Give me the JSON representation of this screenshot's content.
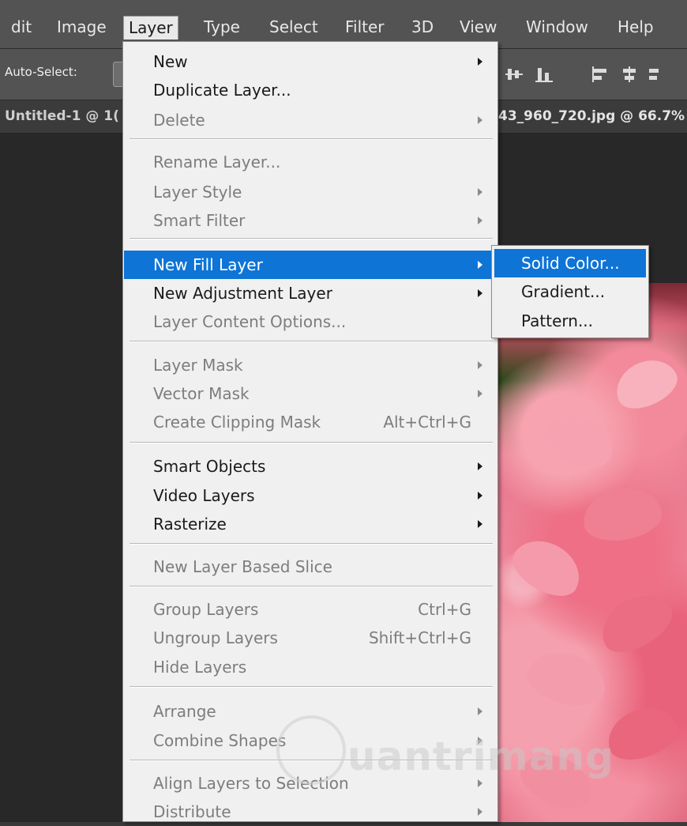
{
  "menubar": {
    "items": [
      {
        "label": "dit"
      },
      {
        "label": "Image"
      },
      {
        "label": "Layer"
      },
      {
        "label": "Type"
      },
      {
        "label": "Select"
      },
      {
        "label": "Filter"
      },
      {
        "label": "3D"
      },
      {
        "label": "View"
      },
      {
        "label": "Window"
      },
      {
        "label": "Help"
      }
    ]
  },
  "options": {
    "auto_select": "Auto-Select:"
  },
  "tabs": {
    "left": "Untitled-1 @ 1(",
    "right": "43_960_720.jpg @ 66.7%"
  },
  "layer_menu": {
    "items": [
      {
        "label": "New",
        "state": "enabled",
        "submenu": true
      },
      {
        "label": "Duplicate Layer...",
        "state": "enabled"
      },
      {
        "label": "Delete",
        "state": "disabled",
        "submenu": true
      },
      {
        "label": "Rename Layer...",
        "state": "disabled"
      },
      {
        "label": "Layer Style",
        "state": "disabled",
        "submenu": true
      },
      {
        "label": "Smart Filter",
        "state": "disabled",
        "submenu": true
      },
      {
        "label": "New Fill Layer",
        "state": "highlighted",
        "submenu": true
      },
      {
        "label": "New Adjustment Layer",
        "state": "enabled",
        "submenu": true
      },
      {
        "label": "Layer Content Options...",
        "state": "disabled"
      },
      {
        "label": "Layer Mask",
        "state": "disabled",
        "submenu": true
      },
      {
        "label": "Vector Mask",
        "state": "disabled",
        "submenu": true
      },
      {
        "label": "Create Clipping Mask",
        "state": "disabled",
        "shortcut": "Alt+Ctrl+G"
      },
      {
        "label": "Smart Objects",
        "state": "enabled",
        "submenu": true
      },
      {
        "label": "Video Layers",
        "state": "enabled",
        "submenu": true
      },
      {
        "label": "Rasterize",
        "state": "enabled",
        "submenu": true
      },
      {
        "label": "New Layer Based Slice",
        "state": "disabled"
      },
      {
        "label": "Group Layers",
        "state": "disabled",
        "shortcut": "Ctrl+G"
      },
      {
        "label": "Ungroup Layers",
        "state": "disabled",
        "shortcut": "Shift+Ctrl+G"
      },
      {
        "label": "Hide Layers",
        "state": "disabled"
      },
      {
        "label": "Arrange",
        "state": "disabled",
        "submenu": true
      },
      {
        "label": "Combine Shapes",
        "state": "disabled",
        "submenu": true
      },
      {
        "label": "Align Layers to Selection",
        "state": "disabled",
        "submenu": true
      },
      {
        "label": "Distribute",
        "state": "disabled",
        "submenu": true
      }
    ]
  },
  "fill_submenu": {
    "items": [
      {
        "label": "Solid Color...",
        "state": "highlighted"
      },
      {
        "label": "Gradient...",
        "state": "enabled"
      },
      {
        "label": "Pattern...",
        "state": "enabled"
      }
    ]
  },
  "watermark": {
    "text": "uantrimang"
  },
  "colors": {
    "highlight": "#0e74d6",
    "menu_bg": "#f0f0f0",
    "menubar_bg": "#535353"
  }
}
